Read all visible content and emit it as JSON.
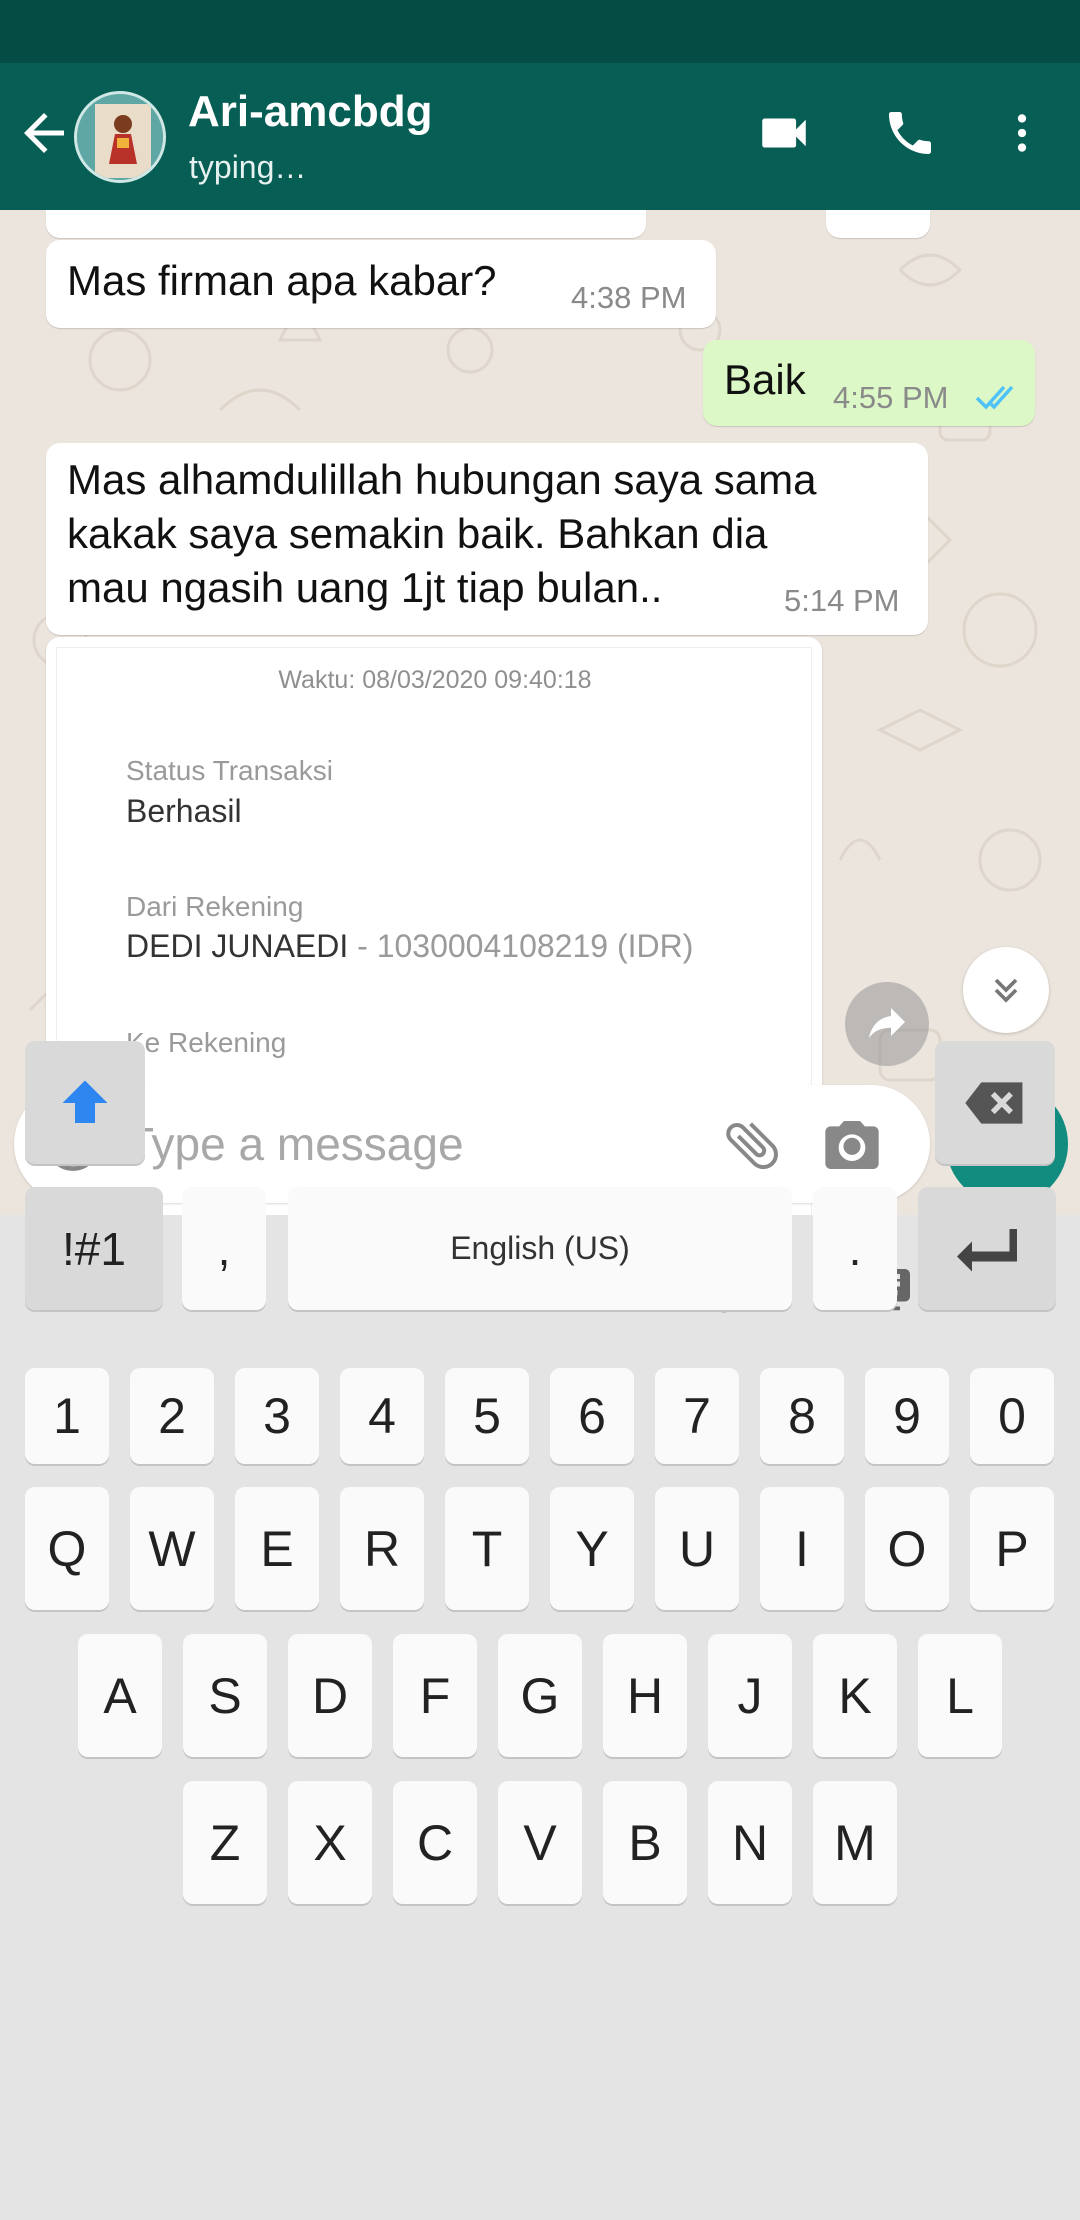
{
  "header": {
    "contact_name": "Ari-amcbdg",
    "contact_status": "typing…"
  },
  "messages": [
    {
      "direction": "in",
      "text": "Mas firman apa kabar?",
      "time": "4:38 PM"
    },
    {
      "direction": "out",
      "text": "Baik",
      "time": "4:55 PM",
      "ticks": "read"
    },
    {
      "direction": "in",
      "text_lines": [
        "Mas alhamdulillah hubungan saya sama",
        "kakak saya semakin baik. Bahkan dia",
        "mau ngasih uang 1jt tiap bulan.."
      ],
      "time": "5:14 PM"
    }
  ],
  "image_message": {
    "waktu": "Waktu: 08/03/2020 09:40:18",
    "status_label": "Status Transaksi",
    "status_value": "Berhasil",
    "from_label": "Dari Rekening",
    "from_name": "DEDI JUNAEDI",
    "from_account": " - 1030004108219 (IDR)",
    "to_label": "Ke Rekening"
  },
  "composer": {
    "placeholder": "Type a message"
  },
  "keyboard": {
    "number_row": [
      "1",
      "2",
      "3",
      "4",
      "5",
      "6",
      "7",
      "8",
      "9",
      "0"
    ],
    "row1": [
      "Q",
      "W",
      "E",
      "R",
      "T",
      "Y",
      "U",
      "I",
      "O",
      "P"
    ],
    "row2": [
      "A",
      "S",
      "D",
      "F",
      "G",
      "H",
      "J",
      "K",
      "L"
    ],
    "row3": [
      "Z",
      "X",
      "C",
      "V",
      "B",
      "N",
      "M"
    ],
    "symbols_label": "!#1",
    "comma_label": ",",
    "space_label": "English (US)",
    "period_label": "."
  },
  "colors": {
    "appbar": "#075e54",
    "statusbar": "#054d44",
    "accent": "#128c7e",
    "outgoing_bubble": "#dcf8c6",
    "read_ticks": "#4fc3f7",
    "shift_arrow": "#2e86f0"
  },
  "icons": [
    "back-arrow-icon",
    "video-call-icon",
    "phone-icon",
    "more-vert-icon",
    "forward-icon",
    "scroll-down-icon",
    "emoji-icon",
    "attach-icon",
    "camera-icon",
    "mic-icon",
    "sticker-icon",
    "gif-heart-icon",
    "voice-input-icon",
    "settings-icon",
    "emoji-keyboard-icon",
    "keyboard-icon",
    "more-horiz-icon",
    "shift-icon",
    "backspace-icon",
    "enter-icon"
  ]
}
